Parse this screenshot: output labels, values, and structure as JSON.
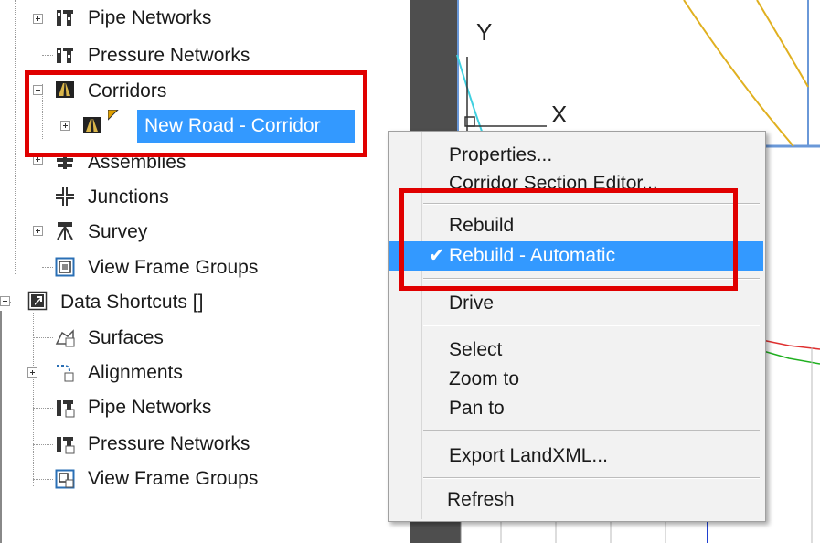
{
  "tree": {
    "items": [
      {
        "label": "Pipe Networks",
        "icon": "pipe-network-icon"
      },
      {
        "label": "Pressure Networks",
        "icon": "pressure-network-icon"
      },
      {
        "label": "Corridors",
        "icon": "corridor-icon"
      },
      {
        "label": "New Road - Corridor",
        "icon": "corridor-icon"
      },
      {
        "label": "Assemblies",
        "icon": "assembly-icon"
      },
      {
        "label": "Junctions",
        "icon": "junction-icon"
      },
      {
        "label": "Survey",
        "icon": "survey-icon"
      },
      {
        "label": "View Frame Groups",
        "icon": "view-frame-icon"
      },
      {
        "label": "Data Shortcuts []",
        "icon": "shortcut-icon"
      },
      {
        "label": "Surfaces",
        "icon": "surface-icon"
      },
      {
        "label": "Alignments",
        "icon": "alignment-icon"
      },
      {
        "label": "Pipe Networks",
        "icon": "pipe-network-icon"
      },
      {
        "label": "Pressure Networks",
        "icon": "pressure-network-icon"
      },
      {
        "label": "View Frame Groups",
        "icon": "view-frame-icon"
      }
    ]
  },
  "viewport": {
    "axis_y": "Y",
    "axis_x": "X"
  },
  "context_menu": {
    "items": [
      {
        "label": "Properties..."
      },
      {
        "label": "Corridor Section Editor..."
      },
      {
        "label": "Rebuild"
      },
      {
        "label": "Rebuild - Automatic",
        "checked": true,
        "check_mark": "✔"
      },
      {
        "label": "Drive"
      },
      {
        "label": "Select"
      },
      {
        "label": "Zoom to"
      },
      {
        "label": "Pan to"
      },
      {
        "label": "Export LandXML..."
      },
      {
        "label": "Refresh"
      }
    ]
  },
  "colors": {
    "highlight": "#3399ff",
    "annotation_red": "#e00000"
  }
}
